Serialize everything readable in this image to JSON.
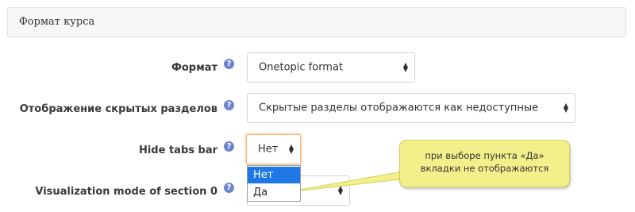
{
  "section": {
    "title": "Формат курса"
  },
  "fields": [
    {
      "label": "Формат",
      "value": "Onetopic format"
    },
    {
      "label": "Отображение скрытых разделов",
      "value": "Скрытые разделы отображаются как недоступные"
    },
    {
      "label": "Hide tabs bar",
      "value": "Нет"
    },
    {
      "label": "Visualization mode of section 0",
      "value": ""
    }
  ],
  "help_icon": {
    "glyph": "?",
    "name": "question-icon",
    "color": "#6c85d1"
  },
  "dropdown": {
    "options": [
      "Нет",
      "Да"
    ],
    "selected": "Нет"
  },
  "callout": {
    "line1": "при выборе пункта «Да»",
    "line2": "вкладки не отображаются",
    "color": "#f3f08c"
  },
  "arrows_glyph": "▲▼"
}
